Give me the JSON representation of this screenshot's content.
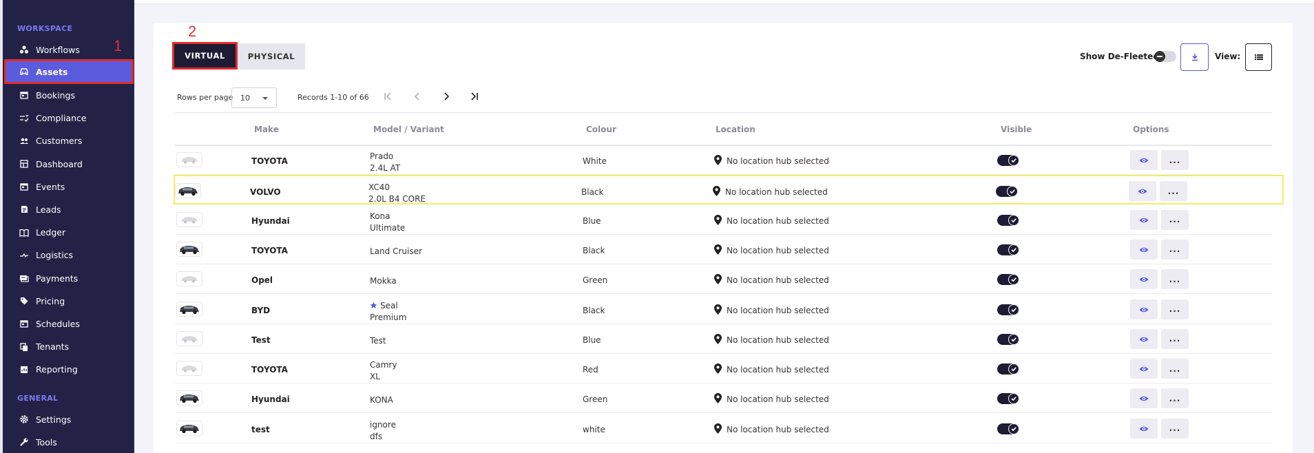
{
  "sidebar": {
    "workspace_title": "WORKSPACE",
    "items": [
      {
        "label": "Workflows",
        "icon": "workflows-icon"
      },
      {
        "label": "Assets",
        "icon": "car-icon",
        "active": true
      },
      {
        "label": "Bookings",
        "icon": "calendar-icon"
      },
      {
        "label": "Compliance",
        "icon": "checklist-icon"
      },
      {
        "label": "Customers",
        "icon": "users-icon"
      },
      {
        "label": "Dashboard",
        "icon": "dashboard-icon"
      },
      {
        "label": "Events",
        "icon": "calendar-icon"
      },
      {
        "label": "Leads",
        "icon": "leads-icon"
      },
      {
        "label": "Ledger",
        "icon": "ledger-icon"
      },
      {
        "label": "Logistics",
        "icon": "logistics-icon"
      },
      {
        "label": "Payments",
        "icon": "payments-icon"
      },
      {
        "label": "Pricing",
        "icon": "tag-icon"
      },
      {
        "label": "Schedules",
        "icon": "calendar-icon"
      },
      {
        "label": "Tenants",
        "icon": "tenants-icon"
      },
      {
        "label": "Reporting",
        "icon": "reporting-icon"
      }
    ],
    "general_title": "GENERAL",
    "general_items": [
      {
        "label": "Settings",
        "icon": "gear-icon"
      },
      {
        "label": "Tools",
        "icon": "wrench-icon"
      }
    ]
  },
  "annotations": {
    "one": "1",
    "two": "2"
  },
  "tabs": {
    "virtual": "VIRTUAL",
    "physical": "PHYSICAL"
  },
  "controls": {
    "show_defleeted_label": "Show De-Fleeted:",
    "view_label": "View:"
  },
  "pagination": {
    "rows_per_page_label": "Rows per page",
    "rows_per_page_value": "10",
    "records_label": "Records 1-10 of 66"
  },
  "table": {
    "headers": {
      "make": "Make",
      "model": "Model / Variant",
      "colour": "Colour",
      "location": "Location",
      "visible": "Visible",
      "options": "Options"
    },
    "more_label": "...",
    "rows": [
      {
        "make": "TOYOTA",
        "model": "Prado",
        "variant": "2.4L AT",
        "colour": "White",
        "location": "No location hub selected",
        "visible": true,
        "photo": false
      },
      {
        "make": "VOLVO",
        "model": "XC40",
        "variant": "2.0L B4 CORE",
        "colour": "Black",
        "location": "No location hub selected",
        "visible": true,
        "photo": true,
        "highlight": true
      },
      {
        "make": "Hyundai",
        "model": "Kona",
        "variant": "Ultimate",
        "colour": "Blue",
        "location": "No location hub selected",
        "visible": true,
        "photo": false
      },
      {
        "make": "TOYOTA",
        "model": "Land Cruiser",
        "variant": "",
        "colour": "Black",
        "location": "No location hub selected",
        "visible": true,
        "photo": true
      },
      {
        "make": "Opel",
        "model": "Mokka",
        "variant": "",
        "colour": "Green",
        "location": "No location hub selected",
        "visible": true,
        "photo": false
      },
      {
        "make": "BYD",
        "model": "Seal",
        "variant": "Premium",
        "colour": "Black",
        "location": "No location hub selected",
        "visible": true,
        "photo": true,
        "starred": true
      },
      {
        "make": "Test",
        "model": "Test",
        "variant": "",
        "colour": "Blue",
        "location": "No location hub selected",
        "visible": true,
        "photo": false
      },
      {
        "make": "TOYOTA",
        "model": "Camry",
        "variant": "XL",
        "colour": "Red",
        "location": "No location hub selected",
        "visible": true,
        "photo": false
      },
      {
        "make": "Hyundai",
        "model": "KONA",
        "variant": "",
        "colour": "Green",
        "location": "No location hub selected",
        "visible": true,
        "photo": true
      },
      {
        "make": "test",
        "model": "ignore",
        "variant": "dfs",
        "colour": "white",
        "location": "No location hub selected",
        "visible": true,
        "photo": true
      }
    ]
  },
  "colors": {
    "accent": "#5b5bde",
    "sidebar": "#232246",
    "annotation": "#e03131",
    "highlight": "#f3ed63"
  }
}
